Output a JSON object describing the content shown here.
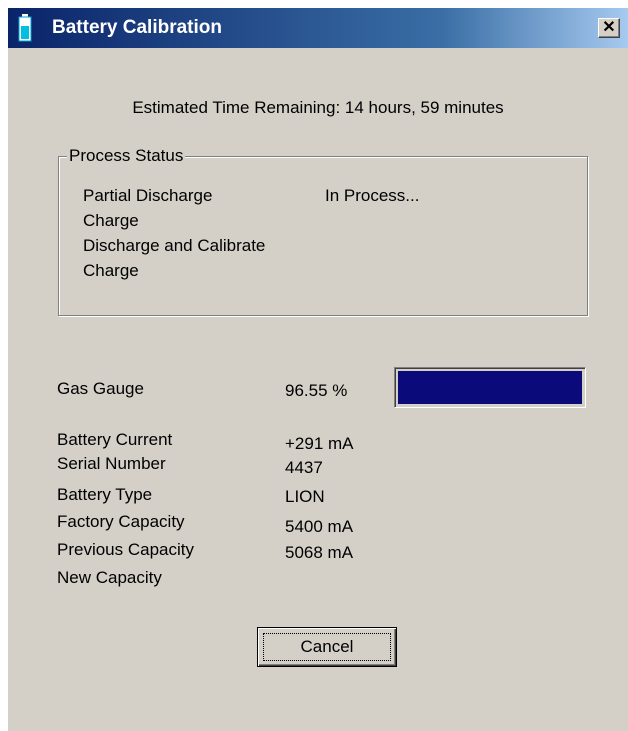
{
  "window": {
    "title": "Battery Calibration",
    "close_glyph": "✕",
    "icon": "battery-icon"
  },
  "estimate": {
    "text": "Estimated Time Remaining:  14 hours, 59 minutes"
  },
  "process_status": {
    "legend": "Process Status",
    "steps": [
      "Partial Discharge",
      "Charge",
      "Discharge and Calibrate",
      "Charge"
    ],
    "current_state": "In Process..."
  },
  "gas_gauge": {
    "label": "Gas Gauge",
    "value_text": "96.55 %",
    "fill_fraction": 1.0,
    "fill_color": "#0a0a7a"
  },
  "battery_info": [
    {
      "label": "Battery Current",
      "value": "+291 mA"
    },
    {
      "label": "Serial Number",
      "value": "4437"
    },
    {
      "label": "Battery Type",
      "value": "LION"
    },
    {
      "label": "Factory Capacity",
      "value": "5400 mA"
    },
    {
      "label": "Previous Capacity",
      "value": "5068 mA"
    },
    {
      "label": "New Capacity",
      "value": ""
    }
  ],
  "buttons": {
    "cancel_label": "Cancel"
  },
  "colors": {
    "titlebar_start": "#0a246a",
    "dialog_face": "#d4d0c8"
  }
}
